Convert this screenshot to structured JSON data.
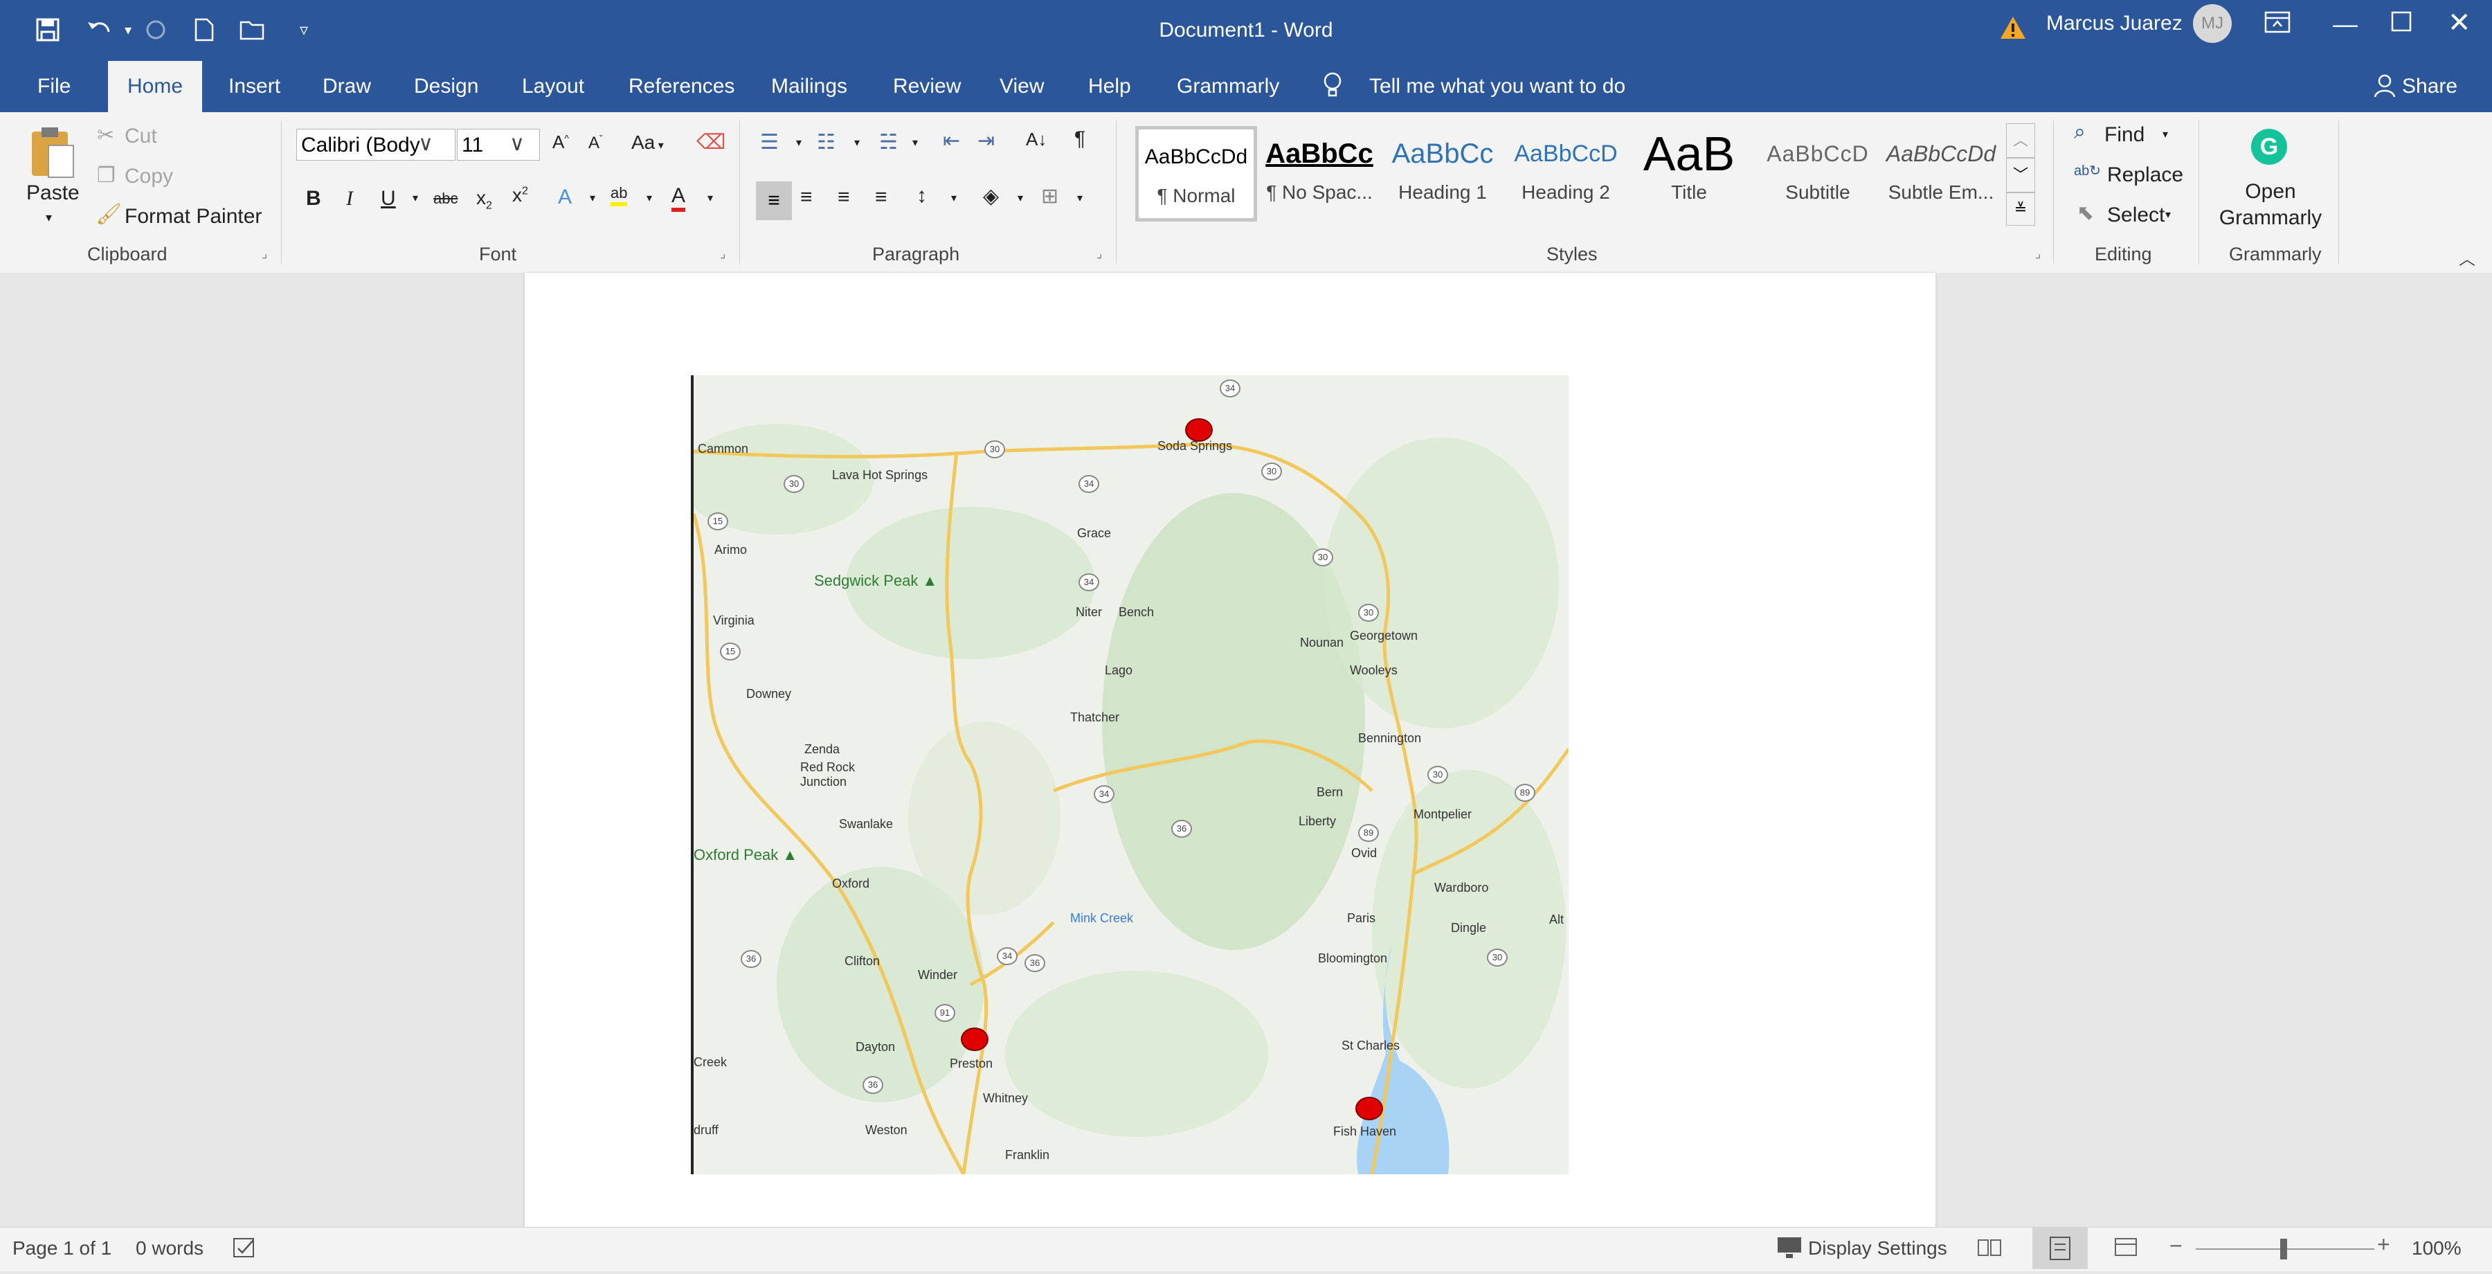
{
  "window": {
    "title": "Document1  -  Word",
    "user_name": "Marcus Juarez",
    "user_initials": "MJ"
  },
  "tabs": [
    "File",
    "Home",
    "Insert",
    "Draw",
    "Design",
    "Layout",
    "References",
    "Mailings",
    "Review",
    "View",
    "Help",
    "Grammarly"
  ],
  "tell_me": "Tell me what you want to do",
  "share": "Share",
  "clipboard": {
    "paste": "Paste",
    "cut": "Cut",
    "copy": "Copy",
    "format_painter": "Format Painter",
    "label": "Clipboard"
  },
  "font": {
    "name": "Calibri (Body",
    "size": "11",
    "label": "Font",
    "case": "Aa"
  },
  "paragraph": {
    "label": "Paragraph"
  },
  "styles": {
    "label": "Styles",
    "items": [
      {
        "sample": "AaBbCcDd",
        "name": "¶ Normal"
      },
      {
        "sample": "AaBbCc",
        "name": "¶ No Spac..."
      },
      {
        "sample": "AaBbCc",
        "name": "Heading 1"
      },
      {
        "sample": "AaBbCcD",
        "name": "Heading 2"
      },
      {
        "sample": "AaB",
        "name": "Title"
      },
      {
        "sample": "AaBbCcD",
        "name": "Subtitle"
      },
      {
        "sample": "AaBbCcDd",
        "name": "Subtle Em..."
      }
    ]
  },
  "editing": {
    "find": "Find",
    "replace": "Replace",
    "select": "Select",
    "label": "Editing"
  },
  "grammarly": {
    "open": "Open Grammarly",
    "label": "Grammarly"
  },
  "map": {
    "towns": [
      "Cammon",
      "Lava Hot Springs",
      "Soda Springs",
      "Grace",
      "Arimo",
      "Virginia",
      "Niter",
      "Bench",
      "Nounan",
      "Georgetown",
      "Wooleys",
      "Lago",
      "Downey",
      "Thatcher",
      "Bennington",
      "Zenda",
      "Red Rock Junction",
      "Bern",
      "Swanlake",
      "Liberty",
      "Montpelier",
      "Ovid",
      "Oxford",
      "Wardboro",
      "Paris",
      "Dingle",
      "Alt",
      "Mink Creek",
      "Clifton",
      "Winder",
      "Bloomington",
      "Preston",
      "Dayton",
      "St Charles",
      "Creek",
      "Whitney",
      "Fish Haven",
      "druff",
      "Weston",
      "Franklin"
    ],
    "peaks": [
      "Sedgwick Peak",
      "Oxford Peak"
    ],
    "shields": [
      "30",
      "30",
      "30",
      "30",
      "30",
      "34",
      "34",
      "34",
      "34",
      "34",
      "15",
      "15",
      "36",
      "36",
      "36",
      "36",
      "89",
      "89",
      "91",
      "30",
      "30"
    ]
  },
  "status": {
    "page": "Page 1 of 1",
    "words": "0 words",
    "display_settings": "Display Settings",
    "zoom": "100%"
  }
}
